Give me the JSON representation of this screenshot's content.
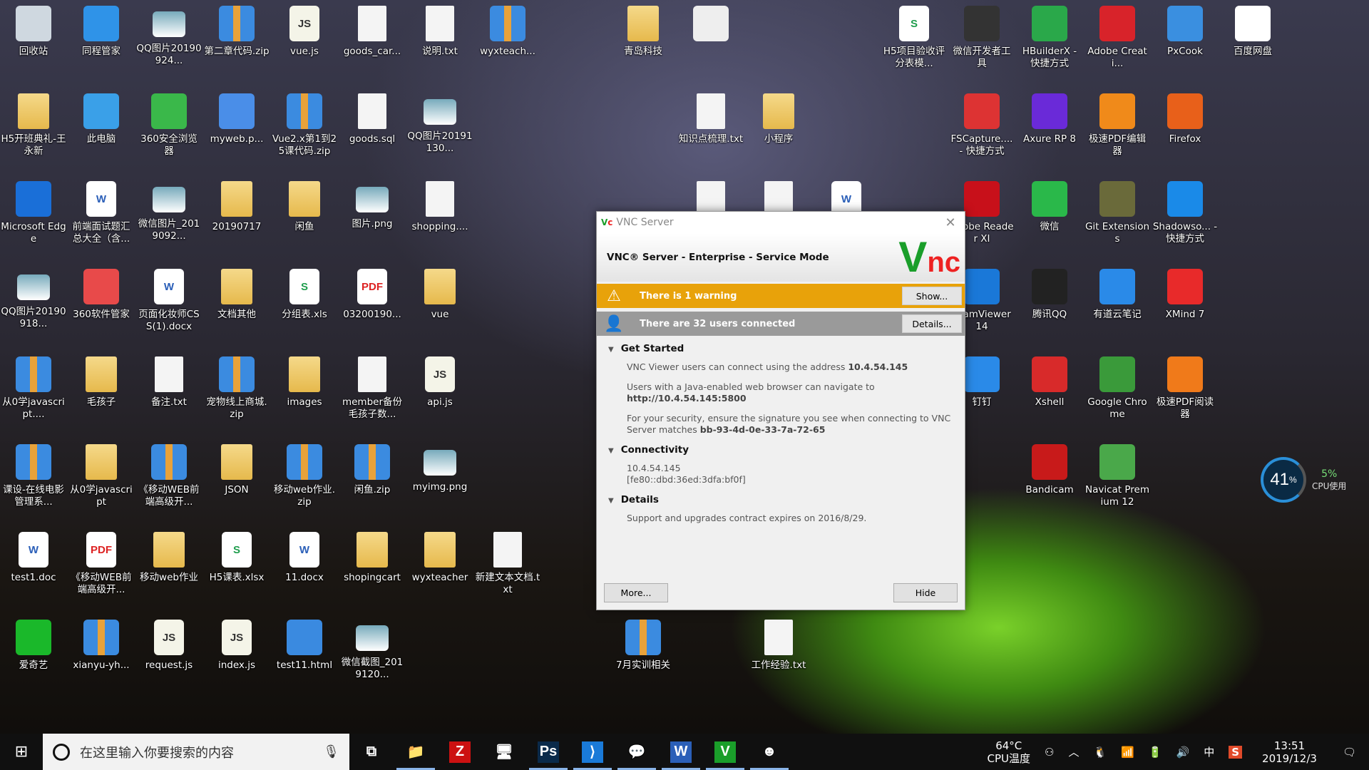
{
  "desktop": {
    "icons": [
      {
        "c": 0,
        "r": 0,
        "label": "回收站",
        "icon": "recycle-bin",
        "kind": "app",
        "color": "#cfd8e0"
      },
      {
        "c": 1,
        "r": 0,
        "label": "同程管家",
        "icon": "tongcheng",
        "kind": "app",
        "color": "#2f93e8"
      },
      {
        "c": 2,
        "r": 0,
        "label": "QQ图片20190924...",
        "icon": "image",
        "kind": "img"
      },
      {
        "c": 3,
        "r": 0,
        "label": "第二章代码.zip",
        "icon": "zip",
        "kind": "zip"
      },
      {
        "c": 4,
        "r": 0,
        "label": "vue.js",
        "icon": "js-file",
        "kind": "js"
      },
      {
        "c": 5,
        "r": 0,
        "label": "goods_car...",
        "icon": "file",
        "kind": "file"
      },
      {
        "c": 6,
        "r": 0,
        "label": "说明.txt",
        "icon": "file",
        "kind": "file"
      },
      {
        "c": 7,
        "r": 0,
        "label": "wyxteach...",
        "icon": "zip",
        "kind": "zip"
      },
      {
        "c": 9,
        "r": 0,
        "label": "青岛科技",
        "icon": "folder",
        "kind": "folder"
      },
      {
        "c": 10,
        "r": 0,
        "label": "",
        "icon": "shirt",
        "kind": "app",
        "color": "#eee"
      },
      {
        "c": 13,
        "r": 0,
        "label": "H5项目验收评分表模...",
        "icon": "xls-file",
        "kind": "xls"
      },
      {
        "c": 14,
        "r": 0,
        "label": "微信开发者工具",
        "icon": "wechat-devtools",
        "kind": "app",
        "color": "#333"
      },
      {
        "c": 15,
        "r": 0,
        "label": "HBuilderX - 快捷方式",
        "icon": "hbuilder",
        "kind": "app",
        "color": "#2aa84a"
      },
      {
        "c": 16,
        "r": 0,
        "label": "Adobe Creati...",
        "icon": "adobe-cc",
        "kind": "app",
        "color": "#d8232a"
      },
      {
        "c": 17,
        "r": 0,
        "label": "PxCook",
        "icon": "pxcook",
        "kind": "app",
        "color": "#3a8fe0"
      },
      {
        "c": 18,
        "r": 0,
        "label": "百度网盘",
        "icon": "baidu-netdisk",
        "kind": "app",
        "color": "#fff"
      },
      {
        "c": 0,
        "r": 1,
        "label": "H5开班典礼-王永新",
        "icon": "folder",
        "kind": "folder"
      },
      {
        "c": 1,
        "r": 1,
        "label": "此电脑",
        "icon": "computer",
        "kind": "app",
        "color": "#3aa0e8"
      },
      {
        "c": 2,
        "r": 1,
        "label": "360安全浏览器",
        "icon": "360-browser",
        "kind": "app",
        "color": "#3ab84a"
      },
      {
        "c": 3,
        "r": 1,
        "label": "myweb.p...",
        "icon": "file",
        "kind": "app",
        "color": "#4a8ee8"
      },
      {
        "c": 4,
        "r": 1,
        "label": "Vue2.x第1到25课代码.zip",
        "icon": "zip",
        "kind": "zip"
      },
      {
        "c": 5,
        "r": 1,
        "label": "goods.sql",
        "icon": "file",
        "kind": "file"
      },
      {
        "c": 6,
        "r": 1,
        "label": "QQ图片20191130...",
        "icon": "image",
        "kind": "img"
      },
      {
        "c": 10,
        "r": 1,
        "label": "知识点梳理.txt",
        "icon": "file",
        "kind": "file"
      },
      {
        "c": 11,
        "r": 1,
        "label": "小程序",
        "icon": "folder",
        "kind": "folder"
      },
      {
        "c": 14,
        "r": 1,
        "label": "FSCapture.... - 快捷方式",
        "icon": "fscapture",
        "kind": "app",
        "color": "#d33"
      },
      {
        "c": 15,
        "r": 1,
        "label": "Axure RP 8",
        "icon": "axure",
        "kind": "app",
        "color": "#6a2ad8"
      },
      {
        "c": 16,
        "r": 1,
        "label": "极速PDF编辑器",
        "icon": "pdf-editor",
        "kind": "app",
        "color": "#f08a1a"
      },
      {
        "c": 17,
        "r": 1,
        "label": "Firefox",
        "icon": "firefox",
        "kind": "app",
        "color": "#e8601a"
      },
      {
        "c": 0,
        "r": 2,
        "label": "Microsoft Edge",
        "icon": "edge",
        "kind": "app",
        "color": "#1a6fd8"
      },
      {
        "c": 1,
        "r": 2,
        "label": "前端面试题汇总大全（含...",
        "icon": "doc-file",
        "kind": "doc"
      },
      {
        "c": 2,
        "r": 2,
        "label": "微信图片_2019092...",
        "icon": "image",
        "kind": "img"
      },
      {
        "c": 3,
        "r": 2,
        "label": "20190717",
        "icon": "folder",
        "kind": "folder"
      },
      {
        "c": 4,
        "r": 2,
        "label": "闲鱼",
        "icon": "folder",
        "kind": "folder"
      },
      {
        "c": 5,
        "r": 2,
        "label": "图片.png",
        "icon": "image",
        "kind": "img"
      },
      {
        "c": 6,
        "r": 2,
        "label": "shopping....",
        "icon": "file",
        "kind": "file"
      },
      {
        "c": 10,
        "r": 2,
        "label": "",
        "icon": "file",
        "kind": "file"
      },
      {
        "c": 11,
        "r": 2,
        "label": "",
        "icon": "file",
        "kind": "file"
      },
      {
        "c": 12,
        "r": 2,
        "label": "",
        "icon": "doc-file",
        "kind": "doc"
      },
      {
        "c": 14,
        "r": 2,
        "label": "Adobe Reader XI",
        "icon": "adobe-reader",
        "kind": "app",
        "color": "#c8101a"
      },
      {
        "c": 15,
        "r": 2,
        "label": "微信",
        "icon": "wechat",
        "kind": "app",
        "color": "#2ab84a"
      },
      {
        "c": 16,
        "r": 2,
        "label": "Git Extensions",
        "icon": "git",
        "kind": "app",
        "color": "#6a6a3a"
      },
      {
        "c": 17,
        "r": 2,
        "label": "Shadowso... - 快捷方式",
        "icon": "shadowsocks",
        "kind": "app",
        "color": "#1a8ae8"
      },
      {
        "c": 0,
        "r": 3,
        "label": "QQ图片20190918...",
        "icon": "image",
        "kind": "img"
      },
      {
        "c": 1,
        "r": 3,
        "label": "360软件管家",
        "icon": "360-manager",
        "kind": "app",
        "color": "#e84a4a"
      },
      {
        "c": 2,
        "r": 3,
        "label": "页面化妆师CSS(1).docx",
        "icon": "doc-file",
        "kind": "doc"
      },
      {
        "c": 3,
        "r": 3,
        "label": "文档其他",
        "icon": "folder",
        "kind": "folder"
      },
      {
        "c": 4,
        "r": 3,
        "label": "分组表.xls",
        "icon": "xls-file",
        "kind": "xls"
      },
      {
        "c": 5,
        "r": 3,
        "label": "03200190...",
        "icon": "pdf-file",
        "kind": "pdf"
      },
      {
        "c": 6,
        "r": 3,
        "label": "vue",
        "icon": "folder",
        "kind": "folder"
      },
      {
        "c": 14,
        "r": 3,
        "label": "TeamViewer 14",
        "icon": "teamviewer",
        "kind": "app",
        "color": "#1a78d8"
      },
      {
        "c": 15,
        "r": 3,
        "label": "腾讯QQ",
        "icon": "qq",
        "kind": "app",
        "color": "#222"
      },
      {
        "c": 16,
        "r": 3,
        "label": "有道云笔记",
        "icon": "youdao-note",
        "kind": "app",
        "color": "#2a8ae8"
      },
      {
        "c": 17,
        "r": 3,
        "label": "XMind 7",
        "icon": "xmind",
        "kind": "app",
        "color": "#e82a2a"
      },
      {
        "c": 0,
        "r": 4,
        "label": "从0学javascript....",
        "icon": "zip",
        "kind": "zip"
      },
      {
        "c": 1,
        "r": 4,
        "label": "毛孩子",
        "icon": "folder",
        "kind": "folder"
      },
      {
        "c": 2,
        "r": 4,
        "label": "备注.txt",
        "icon": "file",
        "kind": "file"
      },
      {
        "c": 3,
        "r": 4,
        "label": "宠物线上商城.zip",
        "icon": "zip",
        "kind": "zip"
      },
      {
        "c": 4,
        "r": 4,
        "label": "images",
        "icon": "folder",
        "kind": "folder"
      },
      {
        "c": 5,
        "r": 4,
        "label": "member备份毛孩子数...",
        "icon": "file",
        "kind": "file"
      },
      {
        "c": 6,
        "r": 4,
        "label": "api.js",
        "icon": "js-file",
        "kind": "js"
      },
      {
        "c": 14,
        "r": 4,
        "label": "钉钉",
        "icon": "dingtalk",
        "kind": "app",
        "color": "#2a8ae8"
      },
      {
        "c": 15,
        "r": 4,
        "label": "Xshell",
        "icon": "xshell",
        "kind": "app",
        "color": "#d82a2a"
      },
      {
        "c": 16,
        "r": 4,
        "label": "Google Chrome",
        "icon": "chrome",
        "kind": "app",
        "color": "#3a9a3a"
      },
      {
        "c": 17,
        "r": 4,
        "label": "极速PDF阅读器",
        "icon": "pdf-reader",
        "kind": "app",
        "color": "#f07a1a"
      },
      {
        "c": 0,
        "r": 5,
        "label": "课设-在线电影管理系...",
        "icon": "zip",
        "kind": "zip"
      },
      {
        "c": 1,
        "r": 5,
        "label": "从0学javascript",
        "icon": "folder",
        "kind": "folder"
      },
      {
        "c": 2,
        "r": 5,
        "label": "《移动WEB前端高级开...",
        "icon": "zip",
        "kind": "zip"
      },
      {
        "c": 3,
        "r": 5,
        "label": "JSON",
        "icon": "folder",
        "kind": "folder"
      },
      {
        "c": 4,
        "r": 5,
        "label": "移动web作业.zip",
        "icon": "zip",
        "kind": "zip"
      },
      {
        "c": 5,
        "r": 5,
        "label": "闲鱼.zip",
        "icon": "zip",
        "kind": "zip"
      },
      {
        "c": 6,
        "r": 5,
        "label": "myimg.png",
        "icon": "image",
        "kind": "img"
      },
      {
        "c": 15,
        "r": 5,
        "label": "Bandicam",
        "icon": "bandicam",
        "kind": "app",
        "color": "#c81a1a"
      },
      {
        "c": 16,
        "r": 5,
        "label": "Navicat Premium 12",
        "icon": "navicat",
        "kind": "app",
        "color": "#4aa84a"
      },
      {
        "c": 0,
        "r": 6,
        "label": "test1.doc",
        "icon": "doc-file",
        "kind": "doc"
      },
      {
        "c": 1,
        "r": 6,
        "label": "《移动WEB前端高级开...",
        "icon": "pdf-file",
        "kind": "pdf"
      },
      {
        "c": 2,
        "r": 6,
        "label": "移动web作业",
        "icon": "folder",
        "kind": "folder"
      },
      {
        "c": 3,
        "r": 6,
        "label": "H5课表.xlsx",
        "icon": "xls-file",
        "kind": "xls"
      },
      {
        "c": 4,
        "r": 6,
        "label": "11.docx",
        "icon": "doc-file",
        "kind": "doc"
      },
      {
        "c": 5,
        "r": 6,
        "label": "shopingcart",
        "icon": "folder",
        "kind": "folder"
      },
      {
        "c": 6,
        "r": 6,
        "label": "wyxteacher",
        "icon": "folder",
        "kind": "folder"
      },
      {
        "c": 7,
        "r": 6,
        "label": "新建文本文档.txt",
        "icon": "file",
        "kind": "file"
      },
      {
        "c": 0,
        "r": 7,
        "label": "爱奇艺",
        "icon": "iqiyi",
        "kind": "app",
        "color": "#1ab82a"
      },
      {
        "c": 1,
        "r": 7,
        "label": "xianyu-yh...",
        "icon": "zip",
        "kind": "zip"
      },
      {
        "c": 2,
        "r": 7,
        "label": "request.js",
        "icon": "js-file",
        "kind": "js"
      },
      {
        "c": 3,
        "r": 7,
        "label": "index.js",
        "icon": "js-file",
        "kind": "js"
      },
      {
        "c": 4,
        "r": 7,
        "label": "test11.html",
        "icon": "chrome",
        "kind": "app",
        "color": "#3a8ae0"
      },
      {
        "c": 5,
        "r": 7,
        "label": "微信截图_2019120...",
        "icon": "image",
        "kind": "img"
      },
      {
        "c": 9,
        "r": 7,
        "label": "7月实训相关",
        "icon": "zip",
        "kind": "zip"
      },
      {
        "c": 11,
        "r": 7,
        "label": "工作经验.txt",
        "icon": "file",
        "kind": "file"
      }
    ]
  },
  "dialog": {
    "title": "VNC Server",
    "logo": "VNC",
    "header": "VNC® Server - Enterprise - Service Mode",
    "warning": "There is 1 warning",
    "show_btn": "Show...",
    "users": "There are 32 users connected",
    "details_btn": "Details...",
    "get_started": {
      "title": "Get Started",
      "p1": "VNC Viewer users can connect using the address ",
      "p1b": "10.4.54.145",
      "p2": "Users with a Java-enabled web browser can navigate to",
      "p2b": "http://10.4.54.145:5800",
      "p3": "For your security, ensure the signature you see when connecting to VNC Server matches ",
      "p3b": "bb-93-4d-0e-33-7a-72-65"
    },
    "connectivity": {
      "title": "Connectivity",
      "ipv4": "10.4.54.145",
      "ipv6": "[fe80::dbd:36ed:3dfa:bf0f]"
    },
    "details": {
      "title": "Details",
      "text": "Support and upgrades contract expires on 2016/8/29."
    },
    "more_btn": "More...",
    "hide_btn": "Hide",
    "accent": "#e8a20a"
  },
  "cpu_widget": {
    "mem": "41",
    "unit": "%",
    "cpu": "5%",
    "cpu_label": "CPU使用"
  },
  "taskbar": {
    "search_placeholder": "在这里输入你要搜索的内容",
    "apps": [
      {
        "icon": "task-view",
        "g": "⧉",
        "active": false
      },
      {
        "icon": "file-explorer",
        "g": "📁",
        "active": true
      },
      {
        "icon": "filezilla",
        "g": "Z",
        "active": false,
        "color": "#c11"
      },
      {
        "icon": "remote-desktop",
        "g": "🖥",
        "active": false
      },
      {
        "icon": "photoshop",
        "g": "Ps",
        "active": true,
        "color": "#0a2a4a"
      },
      {
        "icon": "vscode",
        "g": "⟩",
        "active": true,
        "color": "#1a7ad8"
      },
      {
        "icon": "wechat",
        "g": "💬",
        "active": true
      },
      {
        "icon": "word",
        "g": "W",
        "active": true,
        "color": "#2b5fb8"
      },
      {
        "icon": "vnc",
        "g": "V",
        "active": true,
        "color": "#1a9e2a"
      },
      {
        "icon": "game-app",
        "g": "☻",
        "active": true
      }
    ],
    "temp": "64°C",
    "temp_label": "CPU温度",
    "ime": "中",
    "time": "13:51",
    "date": "2019/12/3"
  }
}
